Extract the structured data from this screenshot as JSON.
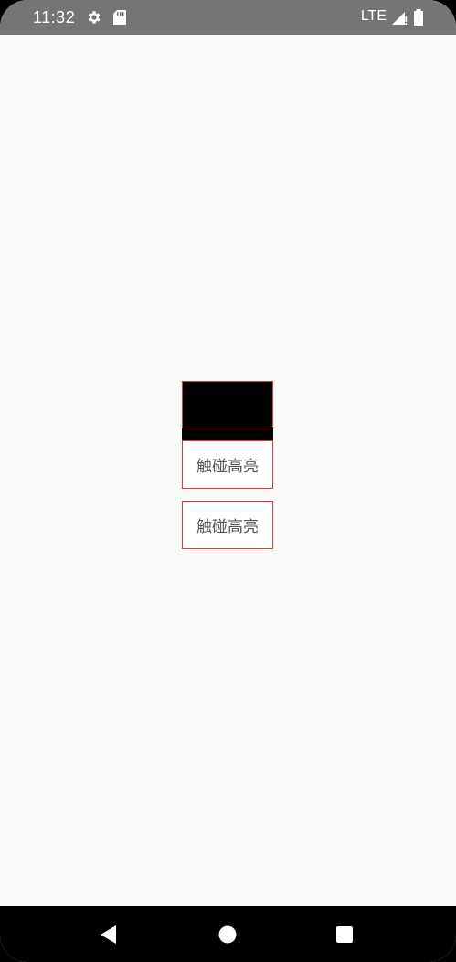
{
  "status_bar": {
    "time": "11:32",
    "network": "LTE",
    "icons": [
      "gear-icon",
      "sd-card-icon",
      "signal-icon",
      "battery-icon"
    ]
  },
  "content": {
    "buttons": [
      {
        "label": "触碰高亮"
      },
      {
        "label": "触碰高亮"
      }
    ],
    "border_color": "#e53935"
  },
  "nav_bar": {
    "icons": [
      "back-icon",
      "home-icon",
      "recents-icon"
    ]
  }
}
